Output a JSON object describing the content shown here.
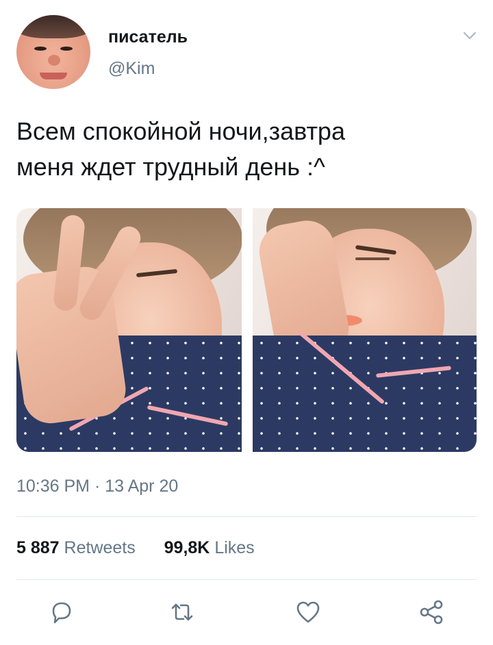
{
  "tweet": {
    "author": {
      "display_name": "писатель",
      "handle": "@Kim"
    },
    "text_lines": [
      "Всем спокойной ночи,завтра",
      "меня ждет трудный день :^"
    ],
    "timestamp": "10:36 PM · 13 Apr 20",
    "stats": {
      "retweets_count": "5 887",
      "retweets_label": "Retweets",
      "likes_count": "99,8K",
      "likes_label": "Likes"
    },
    "actions": [
      "reply-icon",
      "retweet-icon",
      "like-icon",
      "share-icon"
    ],
    "colors": {
      "text": "#14171a",
      "secondary": "#657786",
      "divider": "#e1e8ed",
      "icon": "#657786"
    }
  }
}
